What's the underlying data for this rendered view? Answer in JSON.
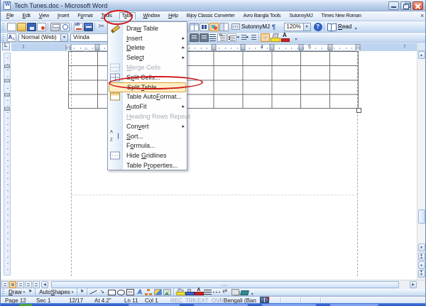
{
  "titlebar": {
    "title": "Tech Tunes.doc - Microsoft Word"
  },
  "menubar": {
    "items": [
      {
        "label": "File",
        "accel": 0
      },
      {
        "label": "Edit",
        "accel": 0
      },
      {
        "label": "View",
        "accel": 0
      },
      {
        "label": "Insert",
        "accel": 0
      },
      {
        "label": "Format",
        "accel": 1
      },
      {
        "label": "Tools",
        "accel": 0
      },
      {
        "label": "Table",
        "accel": 1,
        "open": true
      },
      {
        "label": "Window",
        "accel": 0
      },
      {
        "label": "Help",
        "accel": 0
      },
      {
        "label": "Bijoy Classic Converter",
        "accel": -1
      },
      {
        "label": "Avro Bangla Tools",
        "accel": -1
      },
      {
        "label": "SutonnyMJ",
        "accel": -1
      },
      {
        "label": "Times New Roman",
        "accel": -1
      }
    ],
    "close_glyph": "×"
  },
  "table_menu": {
    "items": [
      {
        "label": "Draw Table",
        "accel": 3,
        "icon": "draw-table"
      },
      {
        "label": "Insert",
        "accel": 0,
        "submenu": true
      },
      {
        "label": "Delete",
        "accel": 0,
        "submenu": true
      },
      {
        "label": "Select",
        "accel": 4,
        "submenu": true
      },
      {
        "label": "Merge Cells",
        "accel": 0,
        "icon": "merge-cells",
        "disabled": true
      },
      {
        "label": "Split Cells...",
        "accel": 1,
        "icon": "split-cells"
      },
      {
        "label": "Split Table",
        "accel": 6,
        "highlighted": true
      },
      {
        "label": "Table AutoFormat...",
        "accel": 10,
        "icon": "table-autoformat"
      },
      {
        "label": "AutoFit",
        "accel": 0,
        "submenu": true
      },
      {
        "label": "Heading Rows Repeat",
        "accel": 0,
        "disabled": true
      },
      {
        "label": "Convert",
        "accel": 3,
        "submenu": true
      },
      {
        "label": "Sort...",
        "accel": 0,
        "icon": "sort"
      },
      {
        "label": "Formula...",
        "accel": 1
      },
      {
        "label": "Hide Gridlines",
        "accel": 5,
        "icon": "hide-gridlines"
      },
      {
        "label": "Table Properties...",
        "accel": 7
      }
    ]
  },
  "toolbar_standard": {
    "left_icons": [
      "new-document",
      "open",
      "save",
      "email",
      "|",
      "print",
      "print-preview",
      "|",
      "spelling",
      "research",
      "|",
      "cut",
      "copy",
      "paste"
    ],
    "right_icons": [
      "insert-table",
      "columns",
      "drawing",
      "document-map"
    ],
    "active_icons": [
      "drawing"
    ],
    "sutonny_label": "SutonnyMJ",
    "pilcrow": "¶",
    "zoom_value": "120%",
    "help_glyph": "?",
    "read_label": "Read",
    "read_accel": 0
  },
  "toolbar_formatting": {
    "style_value": "Normal (Web)",
    "font_value": "Vrinda",
    "right_icons": [
      "align-left",
      "align-right",
      "line-spacing",
      "numbering",
      "bullets",
      "decrease-indent",
      "increase-indent",
      "|",
      "outside-border",
      "highlight",
      "font-color"
    ],
    "active_icons": [
      "outside-border"
    ]
  },
  "ruler": {
    "numbers": [
      {
        "label": "1",
        "dim": true
      },
      {
        "label": "4",
        "dim": false
      },
      {
        "label": "5",
        "dim": false
      },
      {
        "label": "7",
        "dim": true
      }
    ]
  },
  "document": {
    "table": {
      "rows": 4,
      "cols": 10
    }
  },
  "view_buttons": [
    "normal-view",
    "web-layout-view",
    "print-layout-view",
    "outline-view",
    "reading-view"
  ],
  "drawingbar": {
    "draw_label": "Draw",
    "draw_accel": 0,
    "autoshapes_label": "AutoShapes",
    "autoshapes_accel": 4,
    "icons": [
      "pointer",
      "|",
      "line",
      "arrow",
      "rectangle",
      "oval",
      "text-box",
      "word-art",
      "diagram",
      "clip-art",
      "insert-picture",
      "|",
      "fill-color",
      "line-color",
      "font-color2",
      "line-style",
      "dash-style",
      "arrow-style",
      "shadow-style",
      "3d-style"
    ]
  },
  "statusbar": {
    "page": "Page 12",
    "section": "Sec 1",
    "position": "12/17",
    "vertical_position": "At 4.2\"",
    "line": "Ln 11",
    "column": "Col 1",
    "toggles": [
      "REC",
      "TRK",
      "EXT",
      "OVR"
    ],
    "language": "Bengali (Ban"
  },
  "annotations": {
    "color": "#d21616",
    "circled": [
      "Table menu",
      "Split Table command"
    ]
  }
}
